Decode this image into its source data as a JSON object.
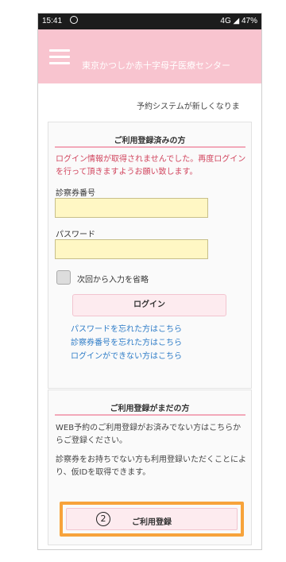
{
  "statusbar": {
    "time": "15:41",
    "right": "4G ◢ 47%"
  },
  "header": {
    "title": "東京かつしか赤十字母子医療センター"
  },
  "notice": "予約システムが新しくなりま",
  "login_card": {
    "title": "ご利用登録済みの方",
    "error": "ログイン情報が取得されませんでした。再度ログインを行って頂きますようお願い致します。",
    "id_label": "診察券番号",
    "password_label": "パスワード",
    "remember_label": "次回から入力を省略",
    "login_button": "ログイン",
    "links": [
      "パスワードを忘れた方はこちら",
      "診察券番号を忘れた方はこちら",
      "ログインができない方はこちら"
    ]
  },
  "register_card": {
    "title": "ご利用登録がまだの方",
    "para1": "WEB予約のご利用登録がお済みでない方はこちらからご登録ください。",
    "para2": "診察券をお持ちでない方も利用登録いただくことにより、仮IDを取得できます。",
    "marker": "2",
    "register_button": "ご利用登録"
  }
}
